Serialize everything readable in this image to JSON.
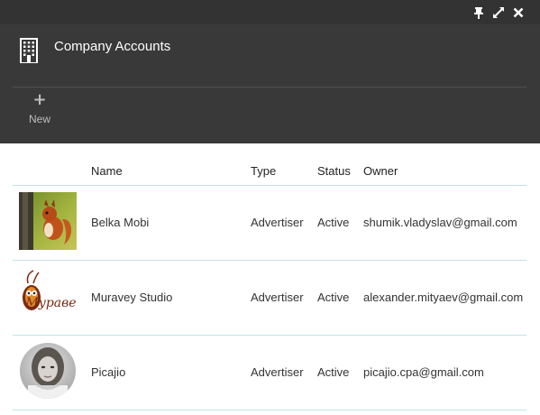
{
  "window": {
    "title": "Company Accounts",
    "controls": [
      "pin-icon",
      "expand-icon",
      "close-icon"
    ]
  },
  "toolbar": {
    "new_label": "New",
    "new_icon": "plus-icon"
  },
  "table": {
    "headers": {
      "name": "Name",
      "type": "Type",
      "status": "Status",
      "owner": "Owner"
    },
    "rows": [
      {
        "name": "Belka Mobi",
        "type": "Advertiser",
        "status": "Active",
        "owner": "shumik.vladyslav@gmail.com",
        "logo": "squirrel-photo"
      },
      {
        "name": "Muravey Studio",
        "type": "Advertiser",
        "status": "Active",
        "owner": "alexander.mityaev@gmail.com",
        "logo": "muravey-logo",
        "logo_text": "Муравей"
      },
      {
        "name": "Picajio",
        "type": "Advertiser",
        "status": "Active",
        "owner": "picajio.cpa@gmail.com",
        "logo": "profile-photo"
      }
    ]
  },
  "colors": {
    "header_bg": "#393939",
    "topbar_bg": "#333333",
    "row_border": "#bfe3ea"
  }
}
